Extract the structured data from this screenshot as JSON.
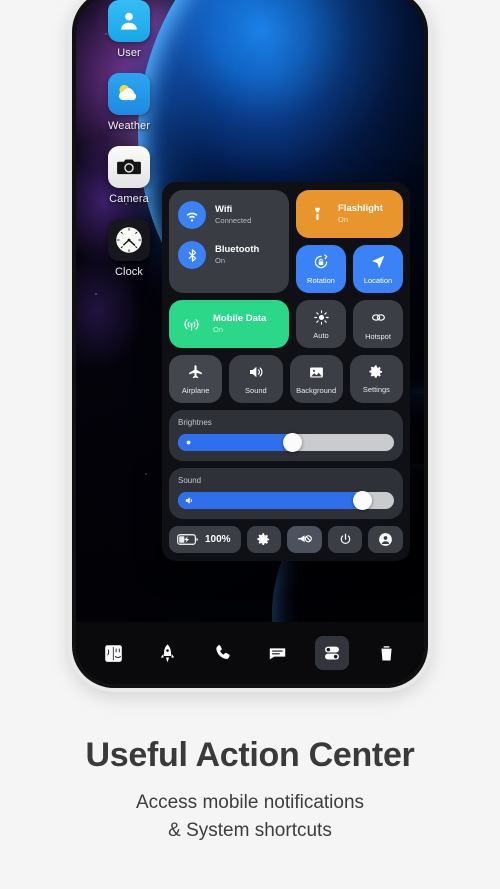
{
  "phone": {
    "home_screen": {
      "apps": [
        {
          "label": "User",
          "icon": "user-icon"
        },
        {
          "label": "Weather",
          "icon": "weather-icon"
        },
        {
          "label": "Camera",
          "icon": "camera-icon"
        },
        {
          "label": "Clock",
          "icon": "clock-icon"
        }
      ]
    },
    "control_center": {
      "connectivity": [
        {
          "title": "Wifi",
          "status": "Connected",
          "icon": "wifi-icon",
          "accent": "#3b82f6"
        },
        {
          "title": "Bluetooth",
          "status": "On",
          "icon": "bluetooth-icon",
          "accent": "#3b82f6"
        }
      ],
      "flashlight": {
        "title": "Flashlight",
        "status": "On",
        "icon": "flashlight-icon",
        "color": "#e8952e"
      },
      "mobile_data": {
        "title": "Mobile Data",
        "status": "On",
        "icon": "mobile-data-icon",
        "color": "#2bd88a"
      },
      "tiles": [
        {
          "label": "Rotation",
          "icon": "rotation-lock-icon",
          "state": "on",
          "color": "#3b82f6"
        },
        {
          "label": "Location",
          "icon": "location-arrow-icon",
          "state": "on",
          "color": "#3b82f6"
        },
        {
          "label": "Auto",
          "icon": "brightness-auto-icon",
          "state": "off",
          "color": "#3b3e44"
        },
        {
          "label": "Hotspot",
          "icon": "hotspot-icon",
          "state": "off",
          "color": "#3b3e44"
        },
        {
          "label": "Airplane",
          "icon": "airplane-icon",
          "state": "off",
          "color": "#43464d"
        },
        {
          "label": "Sound",
          "icon": "speaker-icon",
          "state": "off",
          "color": "#3b3e44"
        },
        {
          "label": "Background",
          "icon": "image-icon",
          "state": "off",
          "color": "#3b3e44"
        },
        {
          "label": "Settings",
          "icon": "gear-icon",
          "state": "off",
          "color": "#3b3e44"
        }
      ],
      "sliders": [
        {
          "label": "Brightnes",
          "icon": "brightness-icon",
          "value": 53
        },
        {
          "label": "Sound",
          "icon": "volume-icon",
          "value": 85
        }
      ],
      "quick_actions": {
        "battery_percent": "100%",
        "battery_icon": "battery-charging-icon",
        "buttons": [
          {
            "icon": "gear-icon",
            "state": "off"
          },
          {
            "icon": "do-not-disturb-icon",
            "state": "on"
          },
          {
            "icon": "power-icon",
            "state": "off"
          },
          {
            "icon": "account-icon",
            "state": "off"
          }
        ]
      }
    },
    "dock": [
      {
        "icon": "finder-icon",
        "selected": false
      },
      {
        "icon": "launchpad-rocket-icon",
        "selected": false
      },
      {
        "icon": "phone-icon",
        "selected": false
      },
      {
        "icon": "messages-icon",
        "selected": false
      },
      {
        "icon": "control-toggles-icon",
        "selected": true
      },
      {
        "icon": "trash-icon",
        "selected": false
      }
    ]
  },
  "caption": {
    "title": "Useful Action Center",
    "line1": "Access mobile notifications",
    "line2": "& System shortcuts"
  }
}
